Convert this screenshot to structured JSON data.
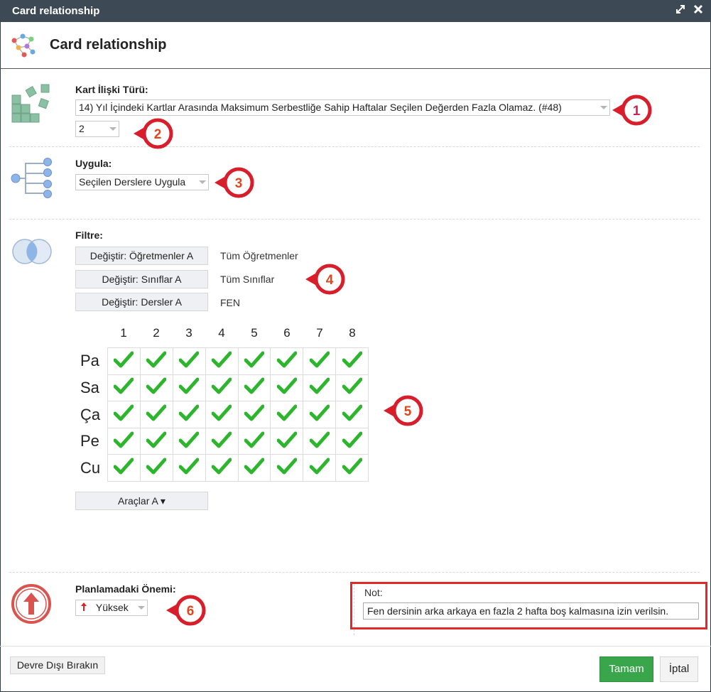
{
  "window": {
    "title": "Card relationship"
  },
  "header": {
    "title": "Card relationship"
  },
  "relation_type": {
    "label": "Kart İlişki Türü:",
    "selected": "14) Yıl İçindeki Kartlar Arasında Maksimum Serbestliğe Sahip Haftalar Seçilen Değerden Fazla Olamaz. (#48)",
    "value": "2"
  },
  "apply": {
    "label": "Uygula:",
    "selected": "Seçilen Derslere Uygula"
  },
  "filter": {
    "label": "Filtre:",
    "rows": [
      {
        "button": "Değiştir: Öğretmenler A",
        "value": "Tüm Öğretmenler"
      },
      {
        "button": "Değiştir: Sınıflar A",
        "value": "Tüm Sınıflar"
      },
      {
        "button": "Değiştir: Dersler A",
        "value": "FEN"
      }
    ]
  },
  "grid": {
    "columns": [
      "1",
      "2",
      "3",
      "4",
      "5",
      "6",
      "7",
      "8"
    ],
    "rows": [
      "Pa",
      "Sa",
      "Ça",
      "Pe",
      "Cu"
    ],
    "all_checked": true
  },
  "tools_button": "Araçlar A ▾",
  "importance": {
    "label": "Planlamadaki Önemi:",
    "selected": "Yüksek"
  },
  "note": {
    "label": "Not:",
    "value": "Fen dersinin arka arkaya en fazla 2 hafta boş kalmasına izin verilsin."
  },
  "footer": {
    "disable": "Devre Dışı Bırakın",
    "ok": "Tamam",
    "cancel": "İptal"
  },
  "badges": [
    "1",
    "2",
    "3",
    "4",
    "5",
    "6"
  ],
  "colors": {
    "titlebar": "#3d4a55",
    "check": "#2db52d",
    "badge_ring": "#d81e2a",
    "ok_button": "#3aa64c",
    "highlight_box": "#e02a2a"
  }
}
